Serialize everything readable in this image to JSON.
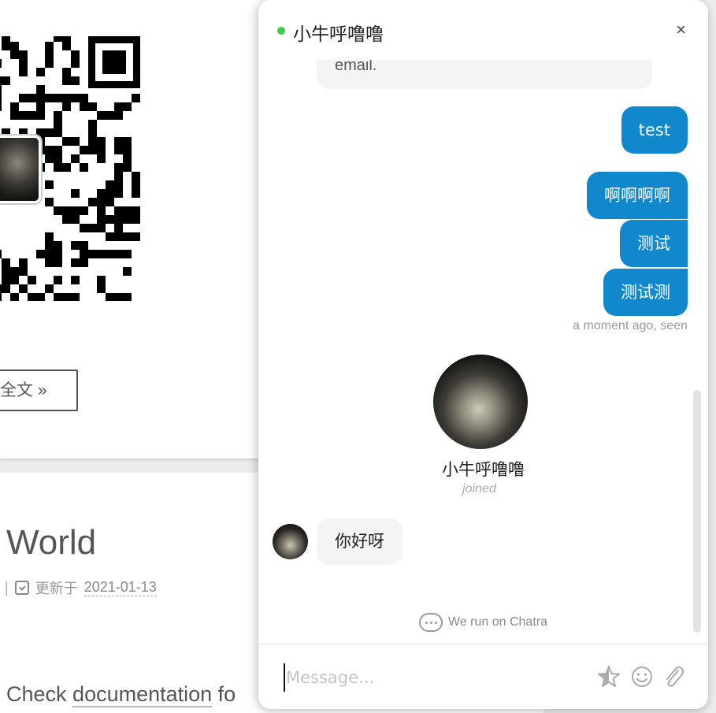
{
  "background": {
    "read_more_label": "全文 »",
    "post_title": "World",
    "meta_separator": "|",
    "updated_label": "更新于",
    "updated_date": "2021-01-13",
    "body_start": "Check ",
    "body_link": "documentation",
    "body_rest": " fo"
  },
  "chat": {
    "title": "小牛呼噜噜",
    "close_glyph": "×",
    "previous_message_tail": "email.",
    "outgoing": [
      {
        "text": "test"
      },
      {
        "text": "啊啊啊啊"
      },
      {
        "text": "测试"
      },
      {
        "text": "测试测"
      }
    ],
    "status": "a moment ago, seen",
    "agent": {
      "name": "小牛呼噜噜",
      "joined": "joined"
    },
    "incoming": [
      {
        "text": "你好呀"
      }
    ],
    "powered_by": "We run on Chatra",
    "composer": {
      "placeholder": "Message..."
    },
    "accent_color": "#1188cc",
    "online_color": "#3fcd4c",
    "icons": [
      "star-icon",
      "smile-icon",
      "attachment-icon",
      "close-icon",
      "chatra-logo-icon"
    ]
  }
}
